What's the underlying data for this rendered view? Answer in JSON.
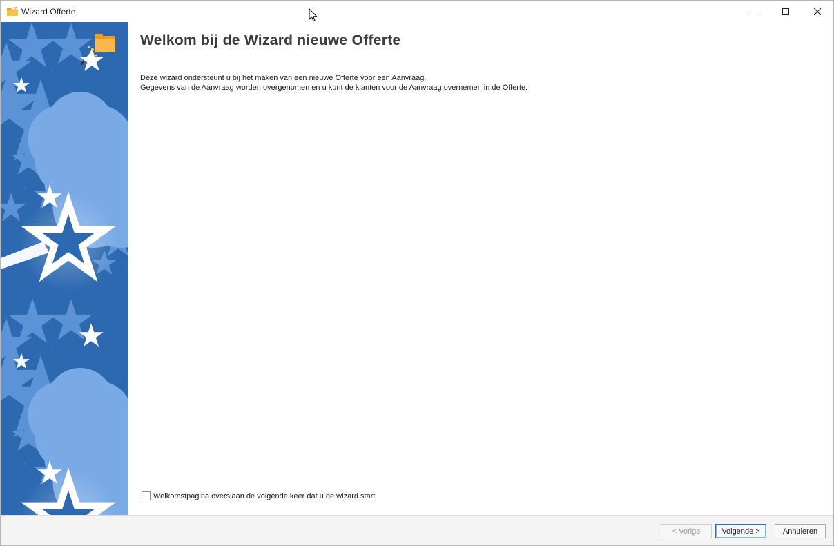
{
  "window": {
    "title": "Wizard Offerte",
    "app_icon": "folder-wand-icon",
    "controls": [
      "minimize-icon",
      "maximize-icon",
      "close-icon"
    ]
  },
  "main": {
    "title": "Welkom bij de Wizard nieuwe Offerte",
    "description_line1": "Deze wizard ondersteunt u bij het maken van een nieuwe Offerte voor een Aanvraag.",
    "description_line2": "Gegevens van de Aanvraag worden overgenomen en u kunt de klanten voor de Aanvraag overnemen in de Offerte.",
    "skip_checkbox": {
      "label": "Welkomstpagina overslaan de volgende keer dat u de wizard start",
      "checked": false
    }
  },
  "footer": {
    "prev_label": "< Vorige",
    "next_label": "Volgende >",
    "cancel_label": "Annuleren"
  },
  "colors": {
    "sidebar": "#2d69b1",
    "accent": "#2f6fc4"
  }
}
